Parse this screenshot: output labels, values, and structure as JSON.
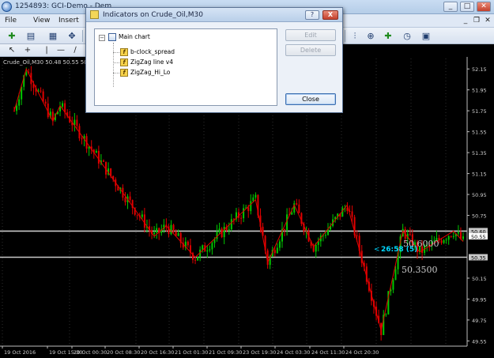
{
  "window": {
    "title": "1254893: GCI-Demo - Dem",
    "minimize_glyph": "_",
    "maximize_glyph": "□",
    "close_glyph": "✕"
  },
  "menu": {
    "items": [
      "File",
      "View",
      "Insert",
      "",
      ""
    ],
    "mdi_buttons": [
      "_",
      "❐",
      "✕"
    ]
  },
  "chart": {
    "label": "Crude_Oil,M30  50.48 50.55 50.48",
    "symbol": "Crude_Oil,M30",
    "background_color": "#000000",
    "grid_color": "#2e2e2e",
    "candle_up_color": "#00c800",
    "candle_down_color": "#e00000",
    "zigzag_color": "#e00000",
    "level_line_color": "#c8c8c8",
    "price_labels": [
      "52.15",
      "51.95",
      "51.75",
      "51.55",
      "51.35",
      "51.15",
      "50.95",
      "50.75",
      "50.60",
      "50.55",
      "50.35",
      "50.15",
      "49.95",
      "49.75",
      "49.55"
    ],
    "time_labels": [
      "19 Oct 2016",
      "19 Oct 15:30",
      "20 Oct 00:30",
      "20 Oct 08:30",
      "20 Oct 16:30",
      "21 Oct 01:30",
      "21 Oct 09:30",
      "23 Oct 19:30",
      "24 Oct 03:30",
      "24 Oct 11:30",
      "24 Oct 20:30"
    ],
    "upper_level_text": "50.6000",
    "lower_level_text": "50.3500",
    "countdown_text": "26:58 (5)",
    "countdown_color": "#00d7ff",
    "current_price_tag": "50.55",
    "upper_level_tag": "50.60",
    "lower_level_tag": "50.35"
  },
  "chart_data": {
    "type": "candlestick",
    "symbol": "Crude_Oil",
    "timeframe": "M30",
    "ylim": [
      49.5,
      52.25
    ],
    "levels": [
      50.6,
      50.35
    ],
    "zigzag": [
      {
        "i": 0,
        "y": 51.75
      },
      {
        "i": 5,
        "y": 52.15
      },
      {
        "i": 16,
        "y": 51.65
      },
      {
        "i": 19,
        "y": 51.8
      },
      {
        "i": 58,
        "y": 50.55
      },
      {
        "i": 63,
        "y": 50.65
      },
      {
        "i": 75,
        "y": 50.35
      },
      {
        "i": 100,
        "y": 50.9
      },
      {
        "i": 105,
        "y": 50.3
      },
      {
        "i": 116,
        "y": 50.85
      },
      {
        "i": 124,
        "y": 50.45
      },
      {
        "i": 138,
        "y": 50.85
      },
      {
        "i": 152,
        "y": 49.65
      },
      {
        "i": 161,
        "y": 50.6
      },
      {
        "i": 168,
        "y": 50.4
      },
      {
        "i": 182,
        "y": 50.6
      },
      {
        "i": 186,
        "y": 50.5
      }
    ],
    "candle_count": 186
  },
  "dialog": {
    "title": "Indicators on Crude_Oil,M30",
    "help_label": "?",
    "close_glyph": "X",
    "tree": {
      "root": "Main chart",
      "children": [
        "b-clock_spread",
        "ZigZag line v4",
        "ZigZag_Hi_Lo"
      ]
    },
    "buttons": {
      "edit": "Edit",
      "delete": "Delete",
      "close": "Close"
    }
  },
  "toolbar": {
    "buttons": [
      "new-chart",
      "profiles",
      "navigator",
      "crosshair-tool",
      "zoom-in",
      "zoom-out",
      "tile",
      "bar-chart",
      "candles",
      "line",
      "period",
      "templates"
    ]
  },
  "icons": {
    "minus": "−",
    "indicator_glyph": "f"
  }
}
